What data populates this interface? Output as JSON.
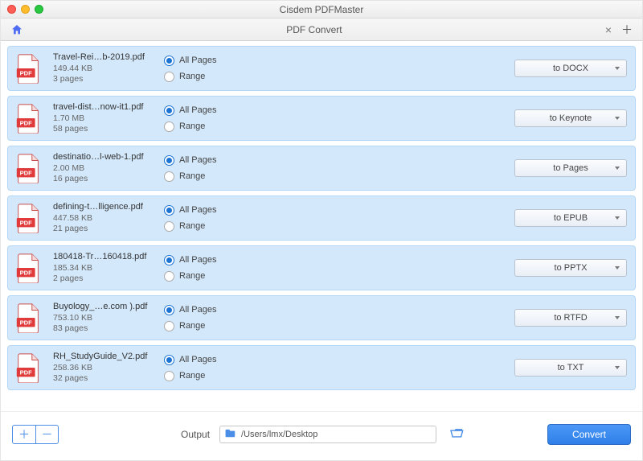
{
  "app_title": "Cisdem PDFMaster",
  "tab_title": "PDF Convert",
  "radio_all": "All Pages",
  "radio_range": "Range",
  "output_label": "Output",
  "output_path": "/Users/lmx/Desktop",
  "convert_label": "Convert",
  "files": [
    {
      "name": "Travel-Rei…b-2019.pdf",
      "size": "149.44 KB",
      "pages": "3 pages",
      "format": "to DOCX"
    },
    {
      "name": "travel-dist…now-it1.pdf",
      "size": "1.70 MB",
      "pages": "58 pages",
      "format": "to Keynote"
    },
    {
      "name": "destinatio…l-web-1.pdf",
      "size": "2.00 MB",
      "pages": "16 pages",
      "format": "to Pages"
    },
    {
      "name": "defining-t…lligence.pdf",
      "size": "447.58 KB",
      "pages": "21 pages",
      "format": "to EPUB"
    },
    {
      "name": "180418-Tr…160418.pdf",
      "size": "185.34 KB",
      "pages": "2 pages",
      "format": "to PPTX"
    },
    {
      "name": "Buyology_…e.com ).pdf",
      "size": "753.10 KB",
      "pages": "83 pages",
      "format": "to RTFD"
    },
    {
      "name": "RH_StudyGuide_V2.pdf",
      "size": "258.36 KB",
      "pages": "32 pages",
      "format": "to TXT"
    }
  ]
}
